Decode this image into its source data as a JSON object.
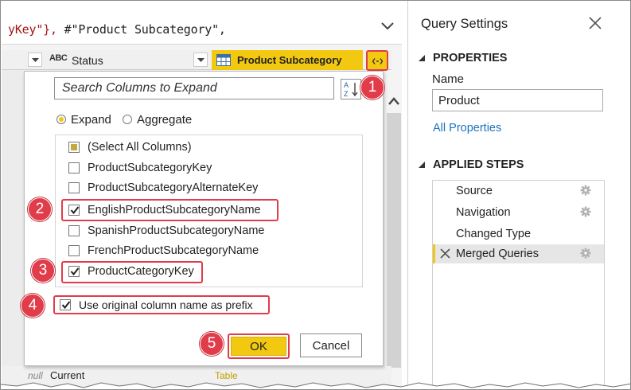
{
  "formula": {
    "string_part": "yKey\"},",
    "rest": " #\"Product Subcategory\","
  },
  "columns": {
    "status_type": "ABC",
    "status_label": "Status",
    "subcategory_label": "Product Subcategory"
  },
  "bottom_row": {
    "null_text": "null",
    "current_text": "Current",
    "table_text": "Table"
  },
  "expand_popup": {
    "search_placeholder": "Search Columns to Expand",
    "expand_label": "Expand",
    "aggregate_label": "Aggregate",
    "mode_selected": "Expand",
    "columns": [
      {
        "label": "(Select All Columns)",
        "state": "partial"
      },
      {
        "label": "ProductSubcategoryKey",
        "state": "unchecked"
      },
      {
        "label": "ProductSubcategoryAlternateKey",
        "state": "unchecked"
      },
      {
        "label": "EnglishProductSubcategoryName",
        "state": "checked"
      },
      {
        "label": "SpanishProductSubcategoryName",
        "state": "unchecked"
      },
      {
        "label": "FrenchProductSubcategoryName",
        "state": "unchecked"
      },
      {
        "label": "ProductCategoryKey",
        "state": "checked"
      }
    ],
    "prefix_label": "Use original column name as prefix",
    "prefix_checked": true,
    "ok_label": "OK",
    "cancel_label": "Cancel"
  },
  "badges": [
    "1",
    "2",
    "3",
    "4",
    "5"
  ],
  "query_settings": {
    "title": "Query Settings",
    "properties_heading": "PROPERTIES",
    "name_label": "Name",
    "name_value": "Product",
    "all_properties_link": "All Properties",
    "applied_steps_heading": "APPLIED STEPS",
    "steps": [
      {
        "label": "Source",
        "has_gear": true,
        "selected": false
      },
      {
        "label": "Navigation",
        "has_gear": true,
        "selected": false
      },
      {
        "label": "Changed Type",
        "has_gear": false,
        "selected": false
      },
      {
        "label": "Merged Queries",
        "has_gear": true,
        "selected": true
      }
    ]
  },
  "colors": {
    "accent_yellow": "#f2c811",
    "callout_red": "#e03c4a",
    "link_blue": "#1e73be"
  },
  "icons": [
    "chevron-down-icon",
    "table-icon",
    "expand-icon",
    "sort-az-icon",
    "close-icon",
    "delete-step-icon",
    "gear-icon",
    "scroll-up-icon"
  ]
}
